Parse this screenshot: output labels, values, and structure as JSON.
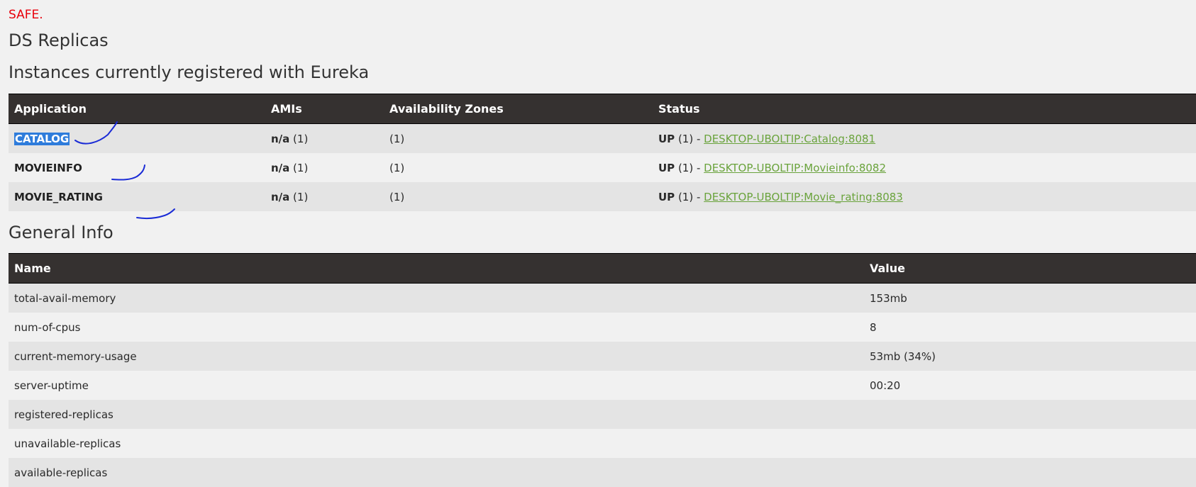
{
  "status_message": "SAFE.",
  "ds_replicas_title": "DS Replicas",
  "instances_title": "Instances currently registered with Eureka",
  "instances_table": {
    "headers": [
      "Application",
      "AMIs",
      "Availability Zones",
      "Status"
    ],
    "rows": [
      {
        "application": "CATALOG",
        "amis_label": "n/a",
        "amis_count": " (1)",
        "zones": "(1)",
        "status_label": "UP",
        "status_count": " (1) - ",
        "link": "DESKTOP-UBOLTIP:Catalog:8081",
        "selected": true
      },
      {
        "application": "MOVIEINFO",
        "amis_label": "n/a",
        "amis_count": " (1)",
        "zones": "(1)",
        "status_label": "UP",
        "status_count": " (1) - ",
        "link": "DESKTOP-UBOLTIP:Movieinfo:8082",
        "selected": false
      },
      {
        "application": "MOVIE_RATING",
        "amis_label": "n/a",
        "amis_count": " (1)",
        "zones": "(1)",
        "status_label": "UP",
        "status_count": " (1) - ",
        "link": "DESKTOP-UBOLTIP:Movie_rating:8083",
        "selected": false
      }
    ]
  },
  "general_info_title": "General Info",
  "general_info_table": {
    "headers": [
      "Name",
      "Value"
    ],
    "rows": [
      {
        "name": "total-avail-memory",
        "value": "153mb"
      },
      {
        "name": "num-of-cpus",
        "value": "8"
      },
      {
        "name": "current-memory-usage",
        "value": "53mb (34%)"
      },
      {
        "name": "server-uptime",
        "value": "00:20"
      },
      {
        "name": "registered-replicas",
        "value": ""
      },
      {
        "name": "unavailable-replicas",
        "value": ""
      },
      {
        "name": "available-replicas",
        "value": ""
      }
    ]
  },
  "colors": {
    "header_bg": "#353130",
    "status_red": "#e8000b",
    "link_green": "#6aa33c",
    "selection_blue": "#2e7cdb",
    "annotation_blue": "#1a2bd6"
  }
}
